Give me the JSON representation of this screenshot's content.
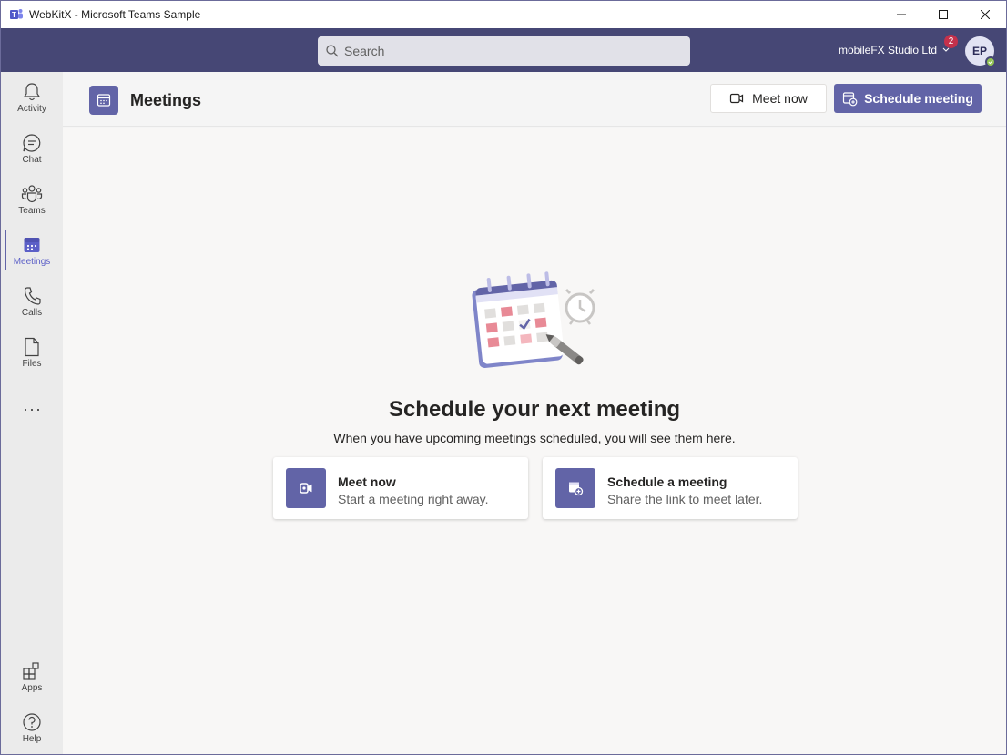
{
  "window": {
    "title": "WebKitX - Microsoft Teams Sample",
    "controls": [
      "minimize",
      "maximize",
      "close"
    ]
  },
  "header": {
    "search_placeholder": "Search",
    "org_name": "mobileFX Studio Ltd",
    "notification_count": "2",
    "avatar_initials": "EP",
    "presence": "available"
  },
  "rail": {
    "items": [
      {
        "label": "Activity",
        "icon": "bell-icon"
      },
      {
        "label": "Chat",
        "icon": "chat-icon"
      },
      {
        "label": "Teams",
        "icon": "teams-icon"
      },
      {
        "label": "Meetings",
        "icon": "calendar-icon",
        "active": true
      },
      {
        "label": "Calls",
        "icon": "phone-icon"
      },
      {
        "label": "Files",
        "icon": "file-icon"
      }
    ],
    "more": "···",
    "bottom": [
      {
        "label": "Apps",
        "icon": "apps-icon"
      },
      {
        "label": "Help",
        "icon": "help-icon"
      }
    ]
  },
  "page": {
    "title": "Meetings",
    "meet_now_label": "Meet now",
    "schedule_label": "Schedule meeting"
  },
  "main": {
    "heading": "Schedule your next meeting",
    "subtext": "When you have upcoming meetings scheduled, you will see them here.",
    "cards": [
      {
        "title": "Meet now",
        "desc": "Start a meeting right away.",
        "icon": "video-icon"
      },
      {
        "title": "Schedule a meeting",
        "desc": "Share the link to meet later.",
        "icon": "calendar-add-icon"
      }
    ]
  },
  "colors": {
    "accent": "#6264a7",
    "header": "#464775",
    "badge": "#c4314b",
    "presence": "#92c353"
  }
}
